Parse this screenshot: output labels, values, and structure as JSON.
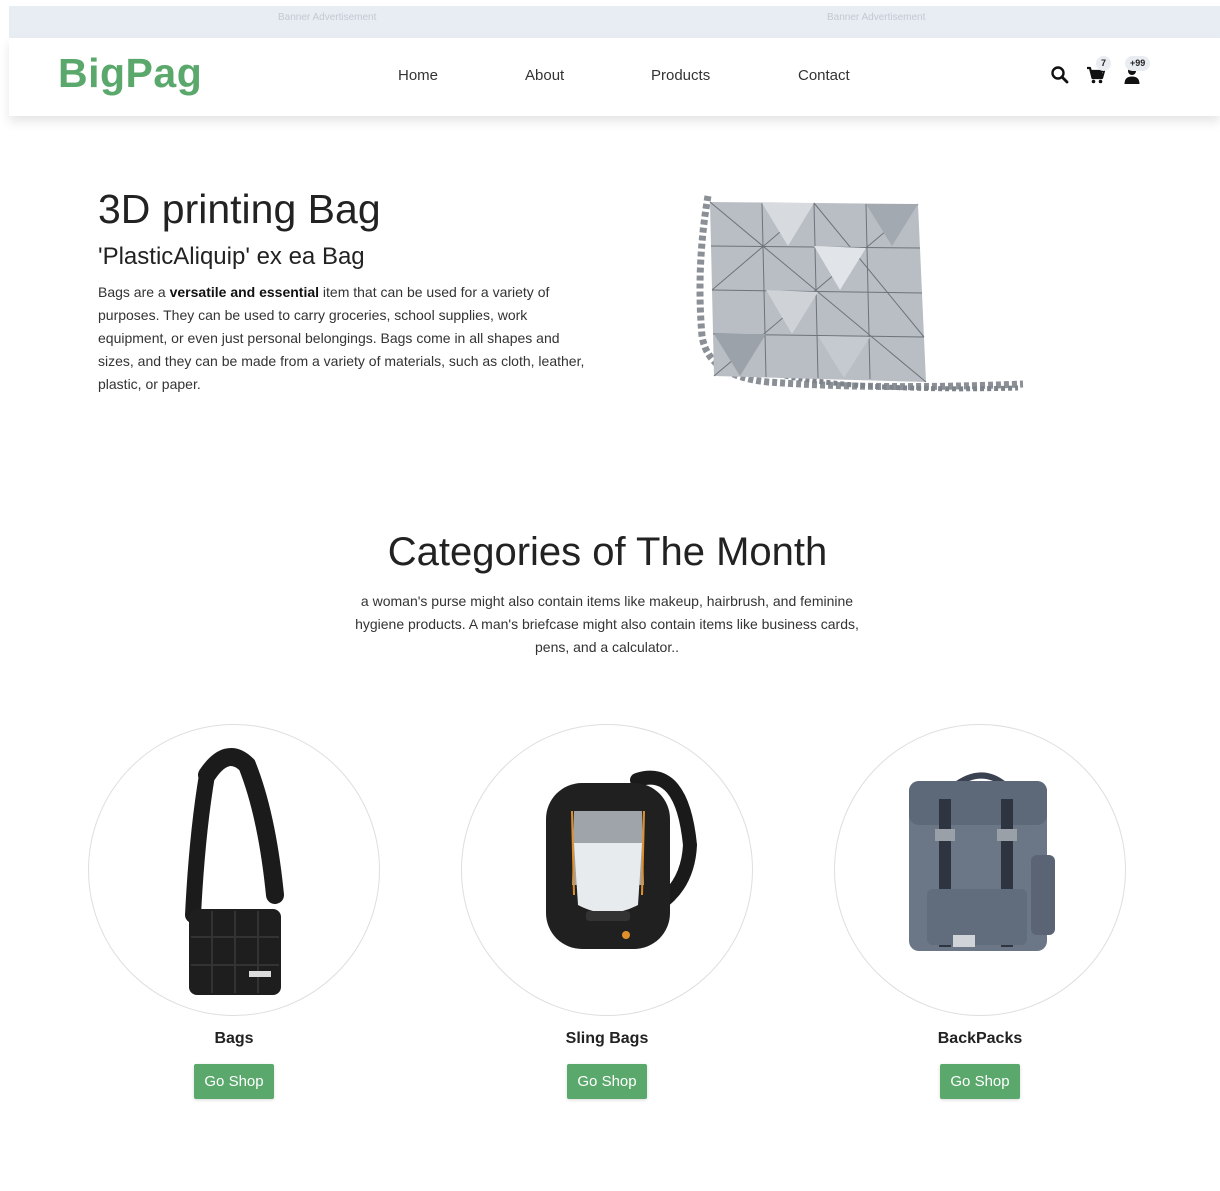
{
  "banner": {
    "left_text": "Banner Advertisement",
    "right_text": "Banner Advertisement"
  },
  "header": {
    "logo": "BigPag",
    "nav": [
      "Home",
      "About",
      "Products",
      "Contact"
    ],
    "icons": {
      "search": "search-icon",
      "cart": "cart-icon",
      "user": "user-icon"
    },
    "cart_count": "7",
    "user_count": "+99"
  },
  "hero": {
    "title": "3D printing Bag",
    "subtitle": "'PlasticAliquip' ex ea Bag",
    "desc_before": "Bags are a ",
    "desc_bold": "versatile and essential",
    "desc_after": " item that can be used for a variety of purposes. They can be used to carry groceries, school supplies, work equipment, or even just personal belongings. Bags come in all shapes and sizes, and they can be made from a variety of materials, such as cloth, leather, plastic, or paper."
  },
  "categories": {
    "title": "Categories of The Month",
    "description": "a woman's purse might also contain items like makeup, hairbrush, and feminine hygiene products. A man's briefcase might also contain items like business cards, pens, and a calculator..",
    "items": [
      {
        "name": "Bags",
        "button": "Go Shop"
      },
      {
        "name": "Sling Bags",
        "button": "Go Shop"
      },
      {
        "name": "BackPacks",
        "button": "Go Shop"
      }
    ]
  },
  "colors": {
    "brand_green": "#5aa86b",
    "banner_bg": "#e8ecf3"
  }
}
